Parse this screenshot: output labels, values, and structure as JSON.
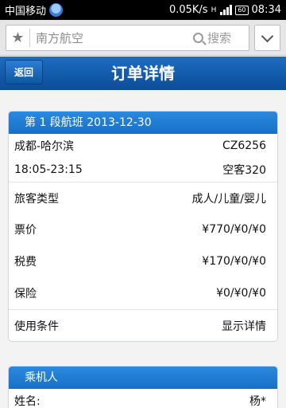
{
  "status_bar": {
    "carrier": "中国移动",
    "speed": "0.05K/s",
    "battery": "60",
    "time": "08:34"
  },
  "search": {
    "query": "南方航空",
    "button": "搜索"
  },
  "header": {
    "back": "返回",
    "title": "订单详情"
  },
  "flight": {
    "heading": "第 1 段航班  2013-12-30",
    "route": "成都-哈尔滨",
    "flight_no": "CZ6256",
    "time": "18:05-23:15",
    "aircraft": "空客320",
    "rows": [
      {
        "label": "旅客类型",
        "value": "成人/儿童/婴儿"
      },
      {
        "label": "票价",
        "value": "¥770/¥0/¥0"
      },
      {
        "label": "税费",
        "value": "¥170/¥0/¥0"
      },
      {
        "label": "保险",
        "value": "¥0/¥0/¥0"
      }
    ],
    "terms_label": "使用条件",
    "terms_link": "显示详情"
  },
  "passenger": {
    "heading": "乘机人",
    "name_label": "姓名:",
    "name_value": "杨*"
  }
}
